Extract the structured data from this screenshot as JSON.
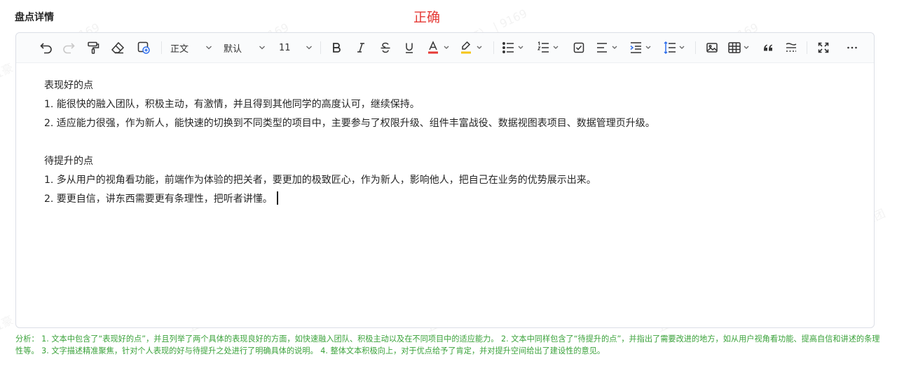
{
  "page_title": "盘点详情",
  "status_label": "正确",
  "toolbar": {
    "paragraph_style": "正文",
    "font_family": "默认",
    "font_size": "11"
  },
  "content": {
    "section1_heading": "表现好的点",
    "section1_items": [
      "1. 能很快的融入团队，积极主动，有激情，并且得到其他同学的高度认可，继续保持。",
      "2. 适应能力很强，作为新人，能快速的切换到不同类型的项目中，主要参与了权限升级、组件丰富战役、数据视图表项目、数据管理页升级。"
    ],
    "section2_heading": "待提升的点",
    "section2_items": [
      "1. 多从用户的视角看功能，前端作为体验的把关者，要更加的极致匠心，作为新人，影响他人，把自己在业务的优势展示出来。",
      "2. 要更自信，讲东西需要更有条理性，把听者讲懂。"
    ]
  },
  "analysis": "分析： 1. 文本中包含了“表现好的点”，并且列举了两个具体的表现良好的方面，如快速融入团队、积极主动以及在不同项目中的适应能力。 2. 文本中同样包含了“待提升的点”，并指出了需要改进的地方，如从用户视角看功能、提高自信和讲述的条理性等。 3. 文字描述精准聚焦，针对个人表现的好与待提升之处进行了明确具体的说明。 4. 整体文本积极向上，对于优点给予了肯定，并对提升空间给出了建设性的意见。",
  "watermark": {
    "lines": [
      "五豪（王雨钉） | 9169",
      "阿里巴巴集团"
    ]
  },
  "colors": {
    "status_red": "#e53935",
    "analysis_green": "#3aa23a",
    "font_color_underline": "#e53935",
    "highlight_underline": "#f5c518"
  },
  "icons": [
    "undo-icon",
    "redo-icon",
    "format-painter-icon",
    "eraser-icon",
    "insert-block-icon",
    "bold-icon",
    "italic-icon",
    "strikethrough-icon",
    "underline-icon",
    "font-color-icon",
    "highlight-icon",
    "bullet-list-icon",
    "ordered-list-icon",
    "checklist-icon",
    "align-icon",
    "indent-icon",
    "line-height-icon",
    "image-icon",
    "table-icon",
    "quote-icon",
    "divider-icon",
    "fullscreen-icon",
    "more-icon"
  ]
}
